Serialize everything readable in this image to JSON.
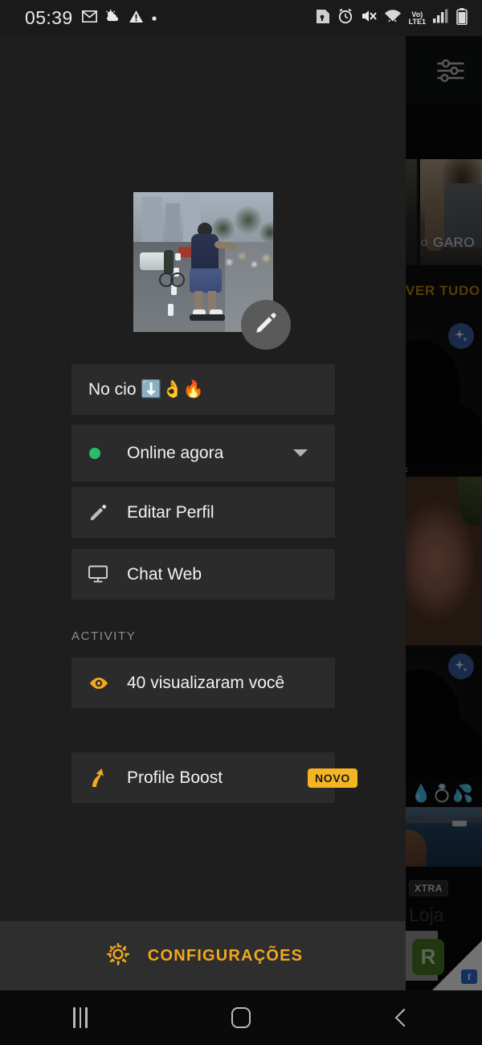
{
  "status_bar": {
    "time": "05:39",
    "left_icons": [
      "gmail-icon",
      "weather-icon",
      "warning-icon",
      "dot-icon"
    ],
    "right_icons": [
      "sd-card-icon",
      "alarm-icon",
      "mute-icon",
      "wifi-icon",
      "volte-lte1-icon",
      "signal-icon",
      "battery-icon"
    ],
    "volte_top": "Vo)",
    "volte_bottom": "LTE1"
  },
  "drawer": {
    "avatar": {
      "name": "profile-photo",
      "edit_icon": "pencil-icon"
    },
    "status_row": {
      "text": "No cio ⬇️👌🔥"
    },
    "online_row": {
      "label": "Online agora",
      "dot_color": "#2bbd6e",
      "chevron": "chevron-down-icon"
    },
    "menu_items": [
      {
        "icon": "pencil-icon",
        "label": "Editar Perfil"
      },
      {
        "icon": "monitor-icon",
        "label": "Chat Web"
      }
    ],
    "activity": {
      "section_title": "ACTIVITY",
      "items": [
        {
          "icon": "eye-icon",
          "label": "40 visualizaram você",
          "badge": null
        },
        {
          "icon": "boost-arrow-icon",
          "label": "Profile Boost",
          "badge": "NOVO"
        }
      ]
    },
    "settings": {
      "icon": "gear-icon",
      "label": "CONFIGURAÇÕES",
      "color": "#f0a81e"
    }
  },
  "background_app": {
    "filter_icon": "sliders-icon",
    "card_label": "○ GARO",
    "see_all": "VER TUDO",
    "emoji_row": "💧💍💦",
    "xtra_badge": "XTRA",
    "store_label": "Loja",
    "green_card_letter": "R",
    "facebook_chip": "f",
    "sparkle_badges": [
      "sparkle-icon",
      "sparkle-icon"
    ],
    "left_chevron": "‹"
  },
  "nav_bar": {
    "recents": "recents-icon",
    "home": "home-icon",
    "back": "back-icon"
  },
  "colors": {
    "drawer_bg": "#1e1e1e",
    "row_bg": "#2b2b2b",
    "accent_amber": "#f0a81e",
    "badge_amber": "#f5b423",
    "online_green": "#2bbd6e",
    "see_all_gold": "#b8860f"
  }
}
